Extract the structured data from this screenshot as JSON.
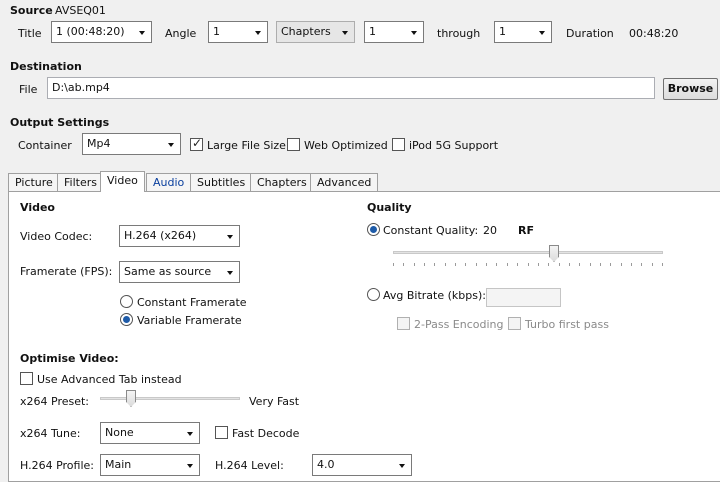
{
  "source": {
    "label": "Source",
    "value": "AVSEQ01",
    "title_label": "Title",
    "title_value": "1 (00:48:20)",
    "angle_label": "Angle",
    "angle_value": "1",
    "range_type": "Chapters",
    "range_start": "1",
    "through_label": "through",
    "range_end": "1",
    "duration_label": "Duration",
    "duration_value": "00:48:20"
  },
  "destination": {
    "label": "Destination",
    "file_label": "File",
    "file_value": "D:\\ab.mp4",
    "browse_label": "Browse"
  },
  "output": {
    "label": "Output Settings",
    "container_label": "Container",
    "container_value": "Mp4",
    "large_file_label": "Large File Size",
    "large_file_checked": true,
    "web_optimized_label": "Web Optimized",
    "web_optimized_checked": false,
    "ipod_label": "iPod 5G Support",
    "ipod_checked": false
  },
  "tabs": [
    "Picture",
    "Filters",
    "Video",
    "Audio",
    "Subtitles",
    "Chapters",
    "Advanced"
  ],
  "active_tab": "Video",
  "video": {
    "section_label": "Video",
    "codec_label": "Video Codec:",
    "codec_value": "H.264 (x264)",
    "framerate_label": "Framerate (FPS):",
    "framerate_value": "Same as source",
    "constant_framerate_label": "Constant Framerate",
    "variable_framerate_label": "Variable Framerate",
    "framerate_mode": "variable"
  },
  "quality": {
    "section_label": "Quality",
    "constant_quality_label": "Constant Quality:",
    "constant_quality_value": "20",
    "rf_label": "RF",
    "quality_slider_fraction": 0.6,
    "avg_bitrate_label": "Avg Bitrate (kbps):",
    "two_pass_label": "2-Pass Encoding",
    "turbo_label": "Turbo first pass",
    "mode": "constant"
  },
  "optimise": {
    "section_label": "Optimise Video:",
    "advanced_tab_label": "Use Advanced Tab instead",
    "preset_label": "x264 Preset:",
    "preset_value": "Very Fast",
    "preset_slider_fraction": 0.2,
    "tune_label": "x264 Tune:",
    "tune_value": "None",
    "fast_decode_label": "Fast Decode",
    "profile_label": "H.264 Profile:",
    "profile_value": "Main",
    "level_label": "H.264 Level:",
    "level_value": "4.0"
  },
  "colors": {
    "background": "#f0f0f0",
    "panel": "#ffffff",
    "radio_accent": "#1e5ba8",
    "tab_highlight": "#0a3f9e"
  }
}
